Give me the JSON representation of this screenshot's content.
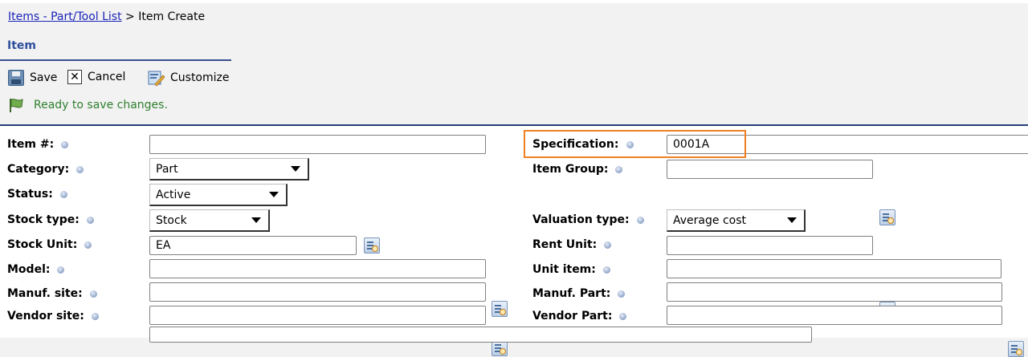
{
  "breadcrumb": {
    "link": "Items - Part/Tool List",
    "separator": " > ",
    "current": "Item Create"
  },
  "section": {
    "title": "Item"
  },
  "toolbar": {
    "save": "Save",
    "cancel": "Cancel",
    "cancel_glyph": "✕",
    "customize": "Customize"
  },
  "status": {
    "message": "Ready to save changes."
  },
  "colors": {
    "highlight": "#f07f23",
    "status": "#2f7f2f",
    "link": "#1a23b8",
    "section_title": "#2f4f9e"
  },
  "form": {
    "item_no": {
      "label": "Item #:",
      "value": ""
    },
    "category": {
      "label": "Category:",
      "value": "Part"
    },
    "status": {
      "label": "Status:",
      "value": "Active"
    },
    "stock_type": {
      "label": "Stock type:",
      "value": "Stock"
    },
    "stock_unit": {
      "label": "Stock Unit:",
      "value": "EA"
    },
    "model": {
      "label": "Model:",
      "value": ""
    },
    "manuf_site": {
      "label": "Manuf. site:",
      "value": ""
    },
    "vendor_site": {
      "label": "Vendor site:",
      "value": ""
    },
    "extra": {
      "value": ""
    },
    "specification": {
      "label": "Specification:",
      "value": "0001A"
    },
    "item_group": {
      "label": "Item Group:",
      "value": ""
    },
    "valuation_type": {
      "label": "Valuation type:",
      "value": "Average cost"
    },
    "rent_unit": {
      "label": "Rent Unit:",
      "value": ""
    },
    "unit_item": {
      "label": "Unit item:",
      "value": ""
    },
    "manuf_part": {
      "label": "Manuf. Part:",
      "value": ""
    },
    "vendor_part": {
      "label": "Vendor Part:",
      "value": ""
    }
  }
}
